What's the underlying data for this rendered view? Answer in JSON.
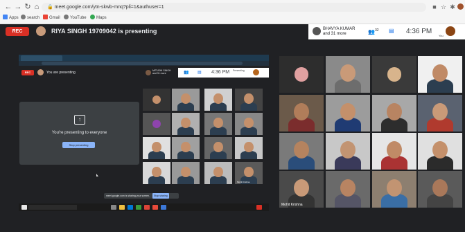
{
  "browser": {
    "url": "meet.google.com/ytn-skwb-mnq?pli=1&authuser=1",
    "bookmarks": [
      "Apps",
      "search",
      "Gmail",
      "YouTube",
      "Maps"
    ]
  },
  "meet": {
    "rec_label": "REC",
    "presenter_title": "RIYA SINGH 19709042 is presenting",
    "participants_label_line1": "BHAVYA KUMAR",
    "participants_label_line2": "and 31 more",
    "participants_count": "32",
    "clock": "4:36 PM",
    "you_label": "You"
  },
  "shared_screen": {
    "rec_label": "REC",
    "you_are_presenting": "You are presenting",
    "presenting_card_text": "You're presenting to everyone",
    "stop_button": "Stop presenting",
    "header_participant_line1": "MITUSHI SINGH",
    "header_participant_line2": "and 31 more",
    "clock": "4:36 PM",
    "presenting_label": "Presenting",
    "notification_text": "meet.google.com is sharing your screen.",
    "notification_button": "Stop sharing",
    "tile_caption": "Mohit Krishna"
  },
  "grid": {
    "tile_caption": "Mohit Krishna"
  }
}
